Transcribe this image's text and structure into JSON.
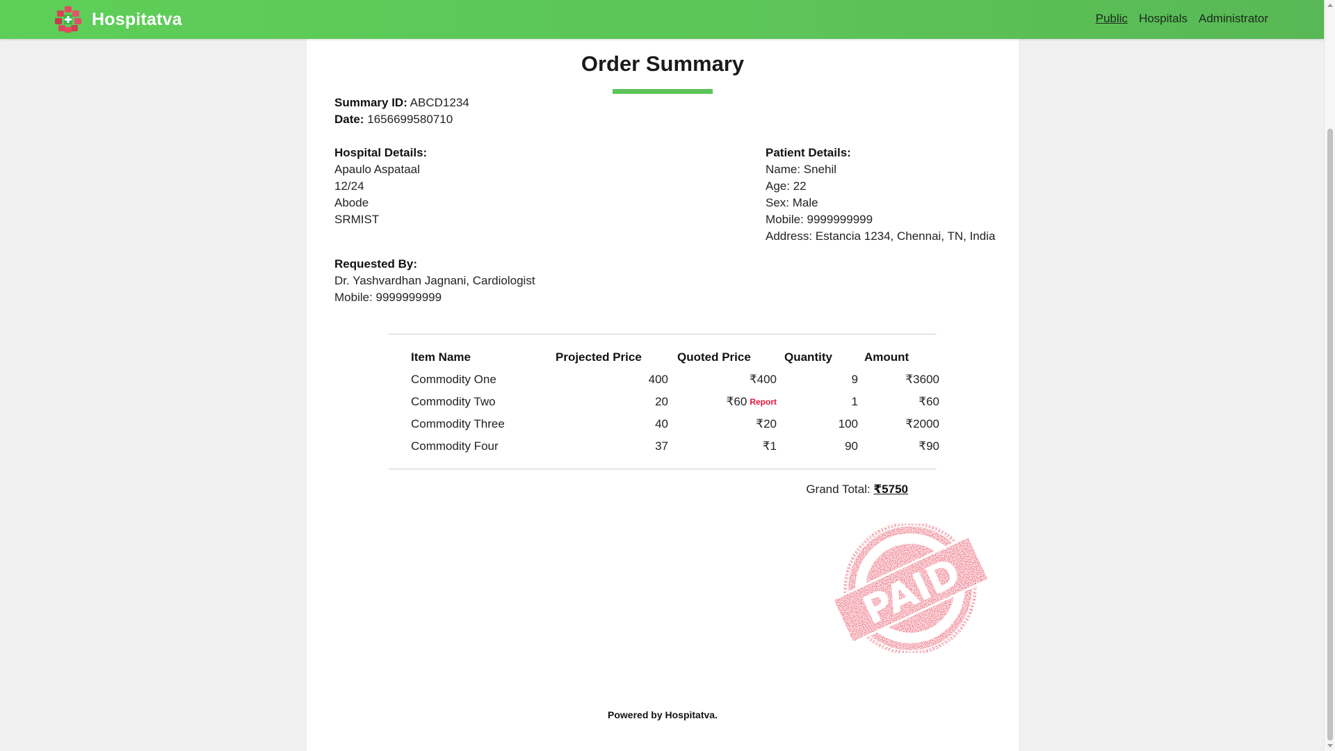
{
  "navbar": {
    "brand": "Hospitatva",
    "links": [
      "Public",
      "Hospitals",
      "Administrator"
    ]
  },
  "page": {
    "title": "Order Summary"
  },
  "summary": {
    "id_label": "Summary ID:",
    "id_value": "ABCD1234",
    "date_label": "Date:",
    "date_value": "1656699580710"
  },
  "hospital": {
    "heading": "Hospital Details:",
    "lines": [
      "Apaulo Aspataal",
      "12/24",
      "Abode",
      "SRMIST"
    ]
  },
  "patient": {
    "heading": "Patient Details:",
    "lines": [
      "Name: Snehil",
      "Age: 22",
      "Sex: Male",
      "Mobile: 9999999999",
      "Address: Estancia 1234, Chennai, TN, India"
    ]
  },
  "requested_by": {
    "heading": "Requested By:",
    "lines": [
      "Dr. Yashvardhan Jagnani, Cardiologist",
      "Mobile: 9999999999"
    ]
  },
  "table": {
    "headers": [
      "Item Name",
      "Projected Price",
      "Quoted Price",
      "Quantity",
      "Amount"
    ],
    "rows": [
      {
        "item": "Commodity One",
        "projected": "400",
        "quoted": "₹400",
        "quantity": "9",
        "amount": "₹3600"
      },
      {
        "item": "Commodity Two",
        "projected": "20",
        "quoted": "₹60",
        "report": "Report",
        "quantity": "1",
        "amount": "₹60"
      },
      {
        "item": "Commodity Three",
        "projected": "40",
        "quoted": "₹20",
        "quantity": "100",
        "amount": "₹2000"
      },
      {
        "item": "Commodity Four",
        "projected": "37",
        "quoted": "₹1",
        "quantity": "90",
        "amount": "₹90"
      }
    ]
  },
  "grand_total": {
    "label": "Grand Total:",
    "value": "₹5750"
  },
  "stamp": {
    "text": "PAID",
    "color": "#e0142d"
  },
  "footer": {
    "text": "Powered by Hospitatva."
  },
  "colors": {
    "accent": "#5cc458",
    "report": "#e0143c"
  }
}
